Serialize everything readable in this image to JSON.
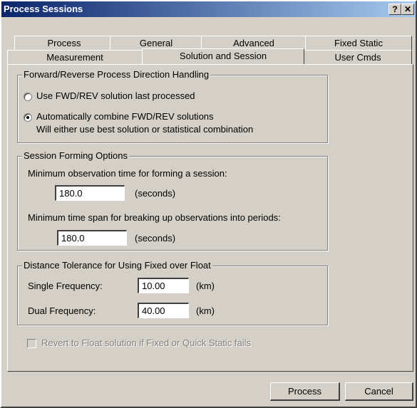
{
  "window": {
    "title": "Process Sessions",
    "help_label": "?",
    "close_label": "✕"
  },
  "tabs": {
    "row1": [
      "Process",
      "General",
      "Advanced",
      "Fixed Static"
    ],
    "row2": [
      "Measurement",
      "Solution and Session",
      "User Cmds"
    ],
    "active": "Solution and Session"
  },
  "direction": {
    "legend": "Forward/Reverse Process Direction Handling",
    "option1": "Use FWD/REV solution last processed",
    "option2": "Automatically combine FWD/REV solutions",
    "option2_note": "Will either use best solution or statistical combination",
    "selected": 2
  },
  "session": {
    "legend": "Session Forming Options",
    "min_obs_label": "Minimum observation time for forming a session:",
    "min_obs_value": "180.0",
    "min_obs_unit": "(seconds)",
    "min_span_label": "Minimum time span for breaking up observations into periods:",
    "min_span_value": "180.0",
    "min_span_unit": "(seconds)"
  },
  "distance": {
    "legend": "Distance Tolerance for Using Fixed over Float",
    "single_label": "Single Frequency:",
    "single_value": "10.00",
    "single_unit": "(km)",
    "dual_label": "Dual Frequency:",
    "dual_value": "40.00",
    "dual_unit": "(km)"
  },
  "revert": {
    "label": "Revert to Float solution if Fixed or Quick Static fails",
    "checked": false,
    "enabled": false
  },
  "buttons": {
    "process": "Process",
    "cancel": "Cancel"
  }
}
